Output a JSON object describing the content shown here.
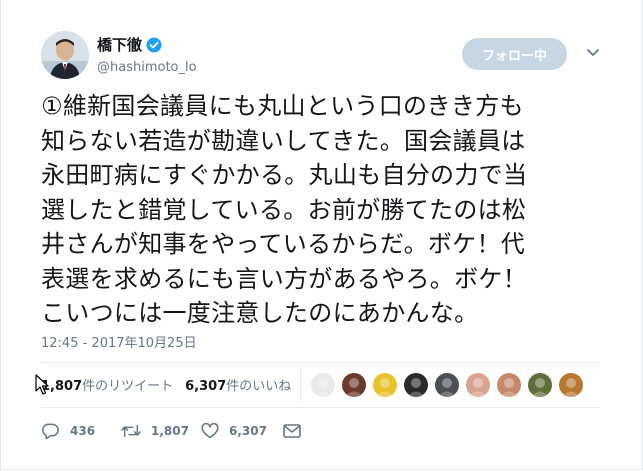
{
  "author": {
    "name": "橋下徹",
    "handle": "@hashimoto_lo",
    "verified": true
  },
  "follow_button": {
    "label": "フォロー中"
  },
  "more_icon": "chevron-down-icon",
  "tweet": {
    "text": "①維新国会議員にも丸山という口のきき方も\n知らない若造が勘違いしてきた。国会議員は\n永田町病にすぐかかる。丸山も自分の力で当\n選したと錯覚している。お前が勝てたのは松\n井さんが知事をやっているからだ。ボケ！代\n表選を求めるにも言い方があるやろ。ボケ！\nこいつには一度注意したのにあかんな。",
    "timestamp": "12:45 - 2017年10月25日"
  },
  "stats": {
    "retweets_count": "1,807",
    "retweets_label": "件のリツイート",
    "likes_count": "6,307",
    "likes_label": "件のいいね"
  },
  "likers": [
    {
      "icon": "avatar-1",
      "color": "#e9e9e9"
    },
    {
      "icon": "avatar-2",
      "color": "#6b3b2e"
    },
    {
      "icon": "avatar-3",
      "color": "#e8c22a"
    },
    {
      "icon": "avatar-4",
      "color": "#2a2a2a"
    },
    {
      "icon": "avatar-5",
      "color": "#4a4f55"
    },
    {
      "icon": "avatar-6",
      "color": "#d9a48f"
    },
    {
      "icon": "avatar-7",
      "color": "#c48a6a"
    },
    {
      "icon": "avatar-8",
      "color": "#5f6f3c"
    },
    {
      "icon": "avatar-9",
      "color": "#b8782f"
    }
  ],
  "actions": {
    "reply_count": "436",
    "retweet_count": "1,807",
    "like_count": "6,307"
  },
  "colors": {
    "text": "#14171a",
    "secondary": "#657786",
    "follow_bg": "#c6d6e3",
    "verified": "#1da1f2",
    "divider": "#e6ecf0"
  }
}
